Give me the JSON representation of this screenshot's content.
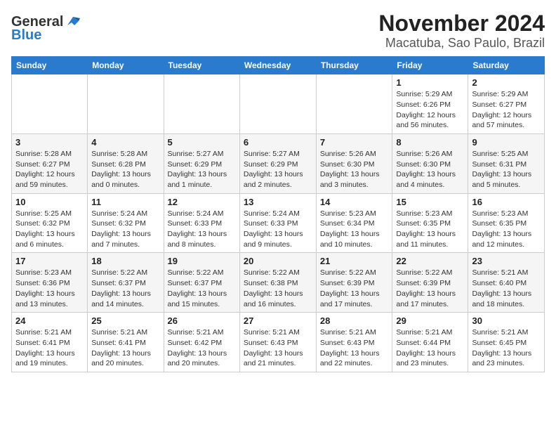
{
  "header": {
    "logo_general": "General",
    "logo_blue": "Blue",
    "month": "November 2024",
    "location": "Macatuba, Sao Paulo, Brazil"
  },
  "weekdays": [
    "Sunday",
    "Monday",
    "Tuesday",
    "Wednesday",
    "Thursday",
    "Friday",
    "Saturday"
  ],
  "weeks": [
    [
      {
        "day": "",
        "info": ""
      },
      {
        "day": "",
        "info": ""
      },
      {
        "day": "",
        "info": ""
      },
      {
        "day": "",
        "info": ""
      },
      {
        "day": "",
        "info": ""
      },
      {
        "day": "1",
        "info": "Sunrise: 5:29 AM\nSunset: 6:26 PM\nDaylight: 12 hours and 56 minutes."
      },
      {
        "day": "2",
        "info": "Sunrise: 5:29 AM\nSunset: 6:27 PM\nDaylight: 12 hours and 57 minutes."
      }
    ],
    [
      {
        "day": "3",
        "info": "Sunrise: 5:28 AM\nSunset: 6:27 PM\nDaylight: 12 hours and 59 minutes."
      },
      {
        "day": "4",
        "info": "Sunrise: 5:28 AM\nSunset: 6:28 PM\nDaylight: 13 hours and 0 minutes."
      },
      {
        "day": "5",
        "info": "Sunrise: 5:27 AM\nSunset: 6:29 PM\nDaylight: 13 hours and 1 minute."
      },
      {
        "day": "6",
        "info": "Sunrise: 5:27 AM\nSunset: 6:29 PM\nDaylight: 13 hours and 2 minutes."
      },
      {
        "day": "7",
        "info": "Sunrise: 5:26 AM\nSunset: 6:30 PM\nDaylight: 13 hours and 3 minutes."
      },
      {
        "day": "8",
        "info": "Sunrise: 5:26 AM\nSunset: 6:30 PM\nDaylight: 13 hours and 4 minutes."
      },
      {
        "day": "9",
        "info": "Sunrise: 5:25 AM\nSunset: 6:31 PM\nDaylight: 13 hours and 5 minutes."
      }
    ],
    [
      {
        "day": "10",
        "info": "Sunrise: 5:25 AM\nSunset: 6:32 PM\nDaylight: 13 hours and 6 minutes."
      },
      {
        "day": "11",
        "info": "Sunrise: 5:24 AM\nSunset: 6:32 PM\nDaylight: 13 hours and 7 minutes."
      },
      {
        "day": "12",
        "info": "Sunrise: 5:24 AM\nSunset: 6:33 PM\nDaylight: 13 hours and 8 minutes."
      },
      {
        "day": "13",
        "info": "Sunrise: 5:24 AM\nSunset: 6:33 PM\nDaylight: 13 hours and 9 minutes."
      },
      {
        "day": "14",
        "info": "Sunrise: 5:23 AM\nSunset: 6:34 PM\nDaylight: 13 hours and 10 minutes."
      },
      {
        "day": "15",
        "info": "Sunrise: 5:23 AM\nSunset: 6:35 PM\nDaylight: 13 hours and 11 minutes."
      },
      {
        "day": "16",
        "info": "Sunrise: 5:23 AM\nSunset: 6:35 PM\nDaylight: 13 hours and 12 minutes."
      }
    ],
    [
      {
        "day": "17",
        "info": "Sunrise: 5:23 AM\nSunset: 6:36 PM\nDaylight: 13 hours and 13 minutes."
      },
      {
        "day": "18",
        "info": "Sunrise: 5:22 AM\nSunset: 6:37 PM\nDaylight: 13 hours and 14 minutes."
      },
      {
        "day": "19",
        "info": "Sunrise: 5:22 AM\nSunset: 6:37 PM\nDaylight: 13 hours and 15 minutes."
      },
      {
        "day": "20",
        "info": "Sunrise: 5:22 AM\nSunset: 6:38 PM\nDaylight: 13 hours and 16 minutes."
      },
      {
        "day": "21",
        "info": "Sunrise: 5:22 AM\nSunset: 6:39 PM\nDaylight: 13 hours and 17 minutes."
      },
      {
        "day": "22",
        "info": "Sunrise: 5:22 AM\nSunset: 6:39 PM\nDaylight: 13 hours and 17 minutes."
      },
      {
        "day": "23",
        "info": "Sunrise: 5:21 AM\nSunset: 6:40 PM\nDaylight: 13 hours and 18 minutes."
      }
    ],
    [
      {
        "day": "24",
        "info": "Sunrise: 5:21 AM\nSunset: 6:41 PM\nDaylight: 13 hours and 19 minutes."
      },
      {
        "day": "25",
        "info": "Sunrise: 5:21 AM\nSunset: 6:41 PM\nDaylight: 13 hours and 20 minutes."
      },
      {
        "day": "26",
        "info": "Sunrise: 5:21 AM\nSunset: 6:42 PM\nDaylight: 13 hours and 20 minutes."
      },
      {
        "day": "27",
        "info": "Sunrise: 5:21 AM\nSunset: 6:43 PM\nDaylight: 13 hours and 21 minutes."
      },
      {
        "day": "28",
        "info": "Sunrise: 5:21 AM\nSunset: 6:43 PM\nDaylight: 13 hours and 22 minutes."
      },
      {
        "day": "29",
        "info": "Sunrise: 5:21 AM\nSunset: 6:44 PM\nDaylight: 13 hours and 23 minutes."
      },
      {
        "day": "30",
        "info": "Sunrise: 5:21 AM\nSunset: 6:45 PM\nDaylight: 13 hours and 23 minutes."
      }
    ]
  ]
}
